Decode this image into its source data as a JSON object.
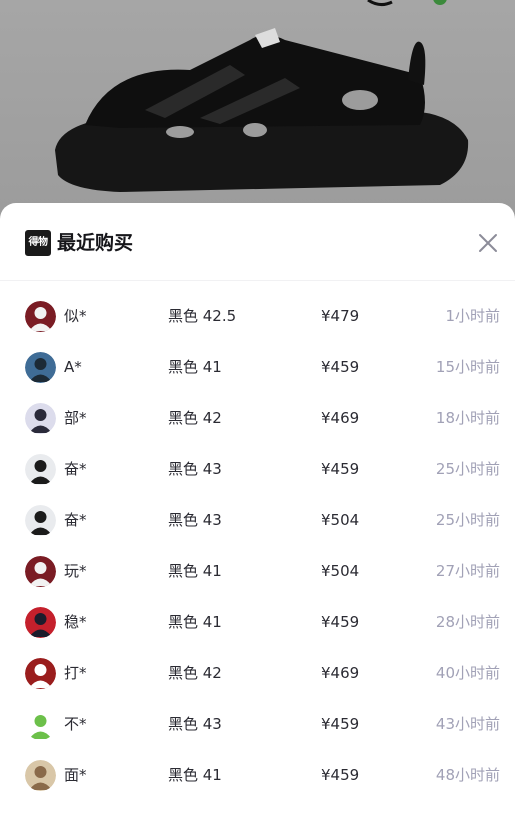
{
  "sheet": {
    "title": "最近购买",
    "brand_logo_text": "得物",
    "close_icon": "close-icon"
  },
  "purchases": [
    {
      "name": "似*",
      "spec": "黑色 42.5",
      "price": "¥479",
      "time": "1小时前",
      "avatar": "red-pattern-avatar",
      "colors": [
        "#7a1c24",
        "#f2f2f2"
      ]
    },
    {
      "name": "A*",
      "spec": "黑色 41",
      "price": "¥459",
      "time": "15小时前",
      "avatar": "sunset-photo-avatar",
      "colors": [
        "#3f6c96",
        "#1c2a36"
      ]
    },
    {
      "name": "部*",
      "spec": "黑色 42",
      "price": "¥469",
      "time": "18小时前",
      "avatar": "cartoon-head-avatar",
      "colors": [
        "#dcdcec",
        "#2a2a3a"
      ]
    },
    {
      "name": "奋*",
      "spec": "黑色 43",
      "price": "¥459",
      "time": "25小时前",
      "avatar": "person-photo-avatar",
      "colors": [
        "#e9ebee",
        "#1b1b1b"
      ]
    },
    {
      "name": "奋*",
      "spec": "黑色 43",
      "price": "¥504",
      "time": "25小时前",
      "avatar": "person-photo-avatar",
      "colors": [
        "#e9ebee",
        "#1b1b1b"
      ]
    },
    {
      "name": "玩*",
      "spec": "黑色 41",
      "price": "¥504",
      "time": "27小时前",
      "avatar": "red-pattern-avatar",
      "colors": [
        "#7a1c24",
        "#f2f2f2"
      ]
    },
    {
      "name": "稳*",
      "spec": "黑色 41",
      "price": "¥459",
      "time": "28小时前",
      "avatar": "anime-red-avatar",
      "colors": [
        "#c4202c",
        "#1c1c2c"
      ]
    },
    {
      "name": "打*",
      "spec": "黑色 42",
      "price": "¥469",
      "time": "40小时前",
      "avatar": "red-text-avatar",
      "colors": [
        "#9a1d1d",
        "#ffffff"
      ]
    },
    {
      "name": "不*",
      "spec": "黑色 43",
      "price": "¥459",
      "time": "43小时前",
      "avatar": "green-monster-avatar",
      "colors": [
        "#ffffff",
        "#6cc04a"
      ]
    },
    {
      "name": "面*",
      "spec": "黑色 41",
      "price": "¥459",
      "time": "48小时前",
      "avatar": "pet-photo-avatar",
      "colors": [
        "#d9c7a8",
        "#8a6a4a"
      ]
    }
  ]
}
